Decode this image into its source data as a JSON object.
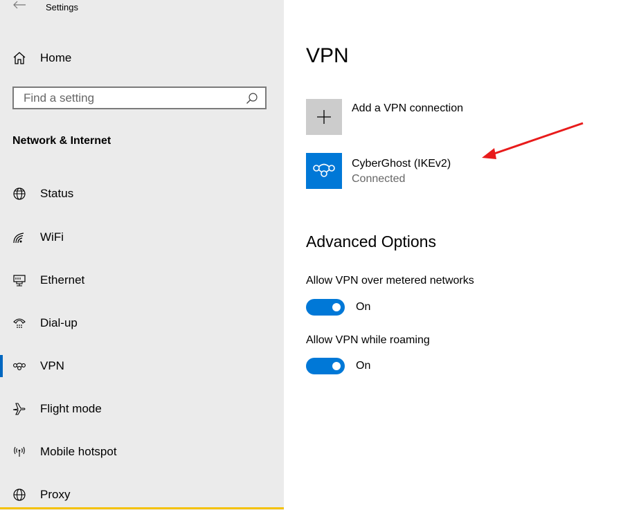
{
  "window": {
    "title": "Settings"
  },
  "sidebar": {
    "home_label": "Home",
    "search_placeholder": "Find a setting",
    "section_header": "Network & Internet",
    "items": [
      {
        "label": "Status",
        "icon": "status-globe-icon"
      },
      {
        "label": "WiFi",
        "icon": "wifi-icon"
      },
      {
        "label": "Ethernet",
        "icon": "ethernet-icon"
      },
      {
        "label": "Dial-up",
        "icon": "dial-up-icon"
      },
      {
        "label": "VPN",
        "icon": "vpn-icon",
        "selected": true
      },
      {
        "label": "Flight mode",
        "icon": "airplane-icon"
      },
      {
        "label": "Mobile hotspot",
        "icon": "hotspot-icon"
      },
      {
        "label": "Proxy",
        "icon": "proxy-globe-icon"
      }
    ]
  },
  "main": {
    "title": "VPN",
    "add_vpn_label": "Add a VPN connection",
    "connection": {
      "name": "CyberGhost (IKEv2)",
      "status": "Connected"
    },
    "advanced_title": "Advanced Options",
    "options": [
      {
        "label": "Allow VPN over metered networks",
        "state": "On"
      },
      {
        "label": "Allow VPN while roaming",
        "state": "On"
      }
    ]
  },
  "colors": {
    "accent": "#0078d7",
    "sidebar_bg": "#ebebeb",
    "annotation_arrow": "#e81b1b"
  }
}
